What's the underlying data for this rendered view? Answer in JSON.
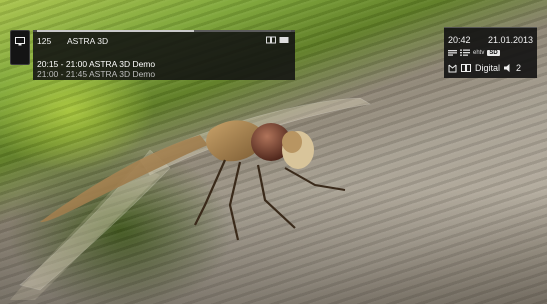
{
  "channel": {
    "number": "125",
    "name": "ASTRA 3D",
    "progress": 0.62,
    "icons": [
      "3d-format-icon",
      "tv-icon"
    ]
  },
  "programme": {
    "now": "20:15 - 21:00 ASTRA 3D Demo",
    "next": "21:00 - 21:45 ASTRA 3D Demo"
  },
  "status": {
    "time": "20:42",
    "date": "21.01.2013",
    "epg_label": "ehtv",
    "sd_badge": "SD",
    "signal_label": "Digital",
    "audio_channels": "2",
    "icons": [
      "subtitles-icon",
      "list-icon",
      "epg-icon",
      "sd-badge",
      "antenna-icon",
      "dolby-icon",
      "speaker-icon"
    ]
  },
  "side_tab": {
    "icon": "monitor-icon"
  },
  "colors": {
    "panel": "#121212",
    "text": "#f2f2f2",
    "muted": "#bdbdbd"
  }
}
